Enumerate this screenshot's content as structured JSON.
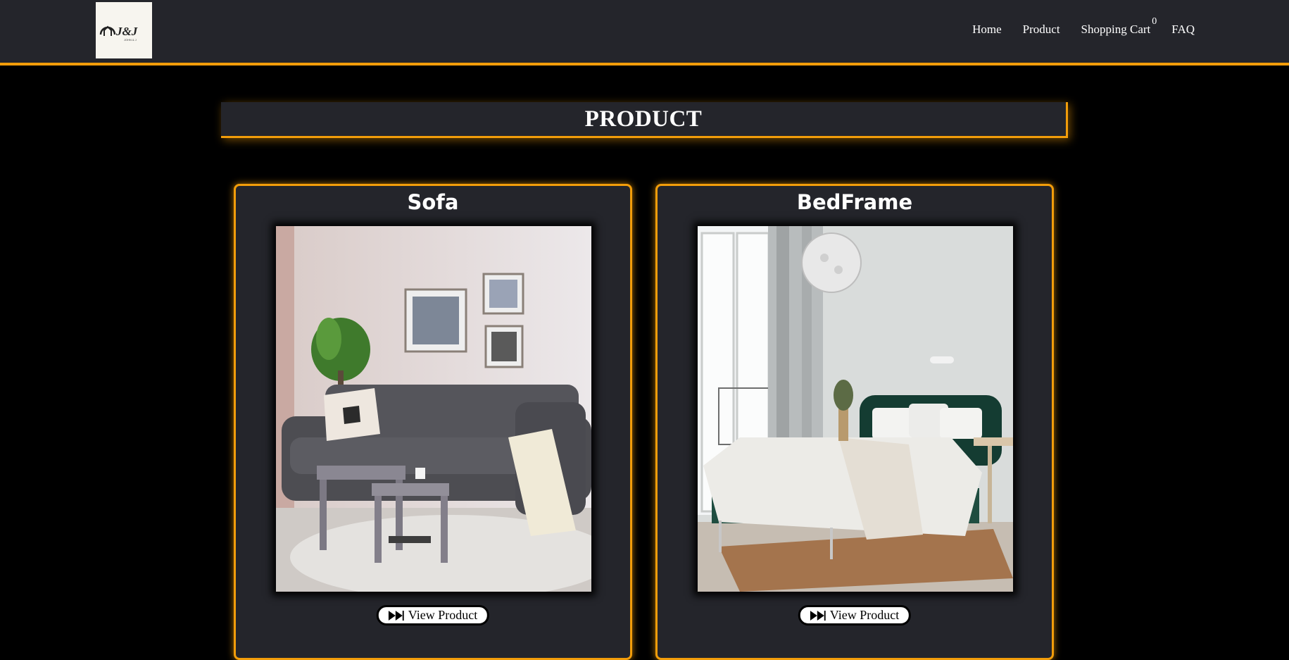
{
  "brand": {
    "logo_text": "J&J",
    "logo_subtext": "JOHN & J"
  },
  "nav": {
    "items": [
      {
        "label": "Home"
      },
      {
        "label": "Product"
      },
      {
        "label": "Shopping Cart"
      },
      {
        "label": "FAQ"
      }
    ],
    "cart_count": "0"
  },
  "page": {
    "heading": "PRODUCT"
  },
  "products": [
    {
      "name": "Sofa",
      "button_label": "View Product",
      "icon": "fast-forward-icon"
    },
    {
      "name": "BedFrame",
      "button_label": "View Product",
      "icon": "fast-forward-icon"
    }
  ],
  "colors": {
    "accent": "#f29d0a",
    "panel": "#24252b",
    "background": "#000000"
  }
}
